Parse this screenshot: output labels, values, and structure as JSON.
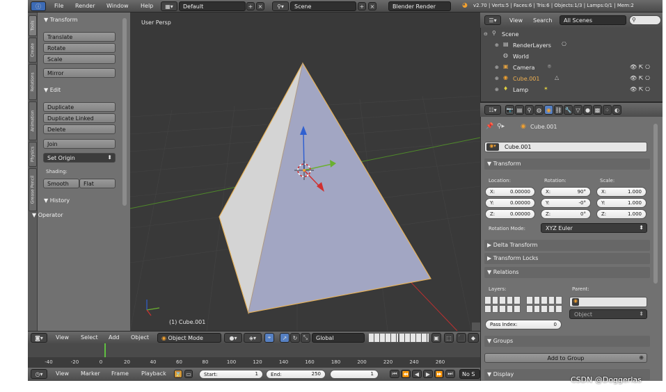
{
  "menu": {
    "items": [
      "File",
      "Render",
      "Window",
      "Help"
    ],
    "screen_layout": "Default",
    "scene": "Scene",
    "engine": "Blender Render",
    "stats": "v2.70 | Verts:5 | Faces:6 | Tris:6 | Objects:1/3 | Lamps:0/1 | Mem:2"
  },
  "toolshelf": {
    "tabs": [
      "Tools",
      "Create",
      "Relations",
      "Animation",
      "Physics",
      "Grease Pencil"
    ],
    "transform_header": "▼ Transform",
    "translate": "Translate",
    "rotate": "Rotate",
    "scale": "Scale",
    "mirror": "Mirror",
    "edit_header": "▼ Edit",
    "duplicate": "Duplicate",
    "duplicate_linked": "Duplicate Linked",
    "delete": "Delete",
    "join": "Join",
    "set_origin": "Set Origin",
    "shading_label": "Shading:",
    "smooth": "Smooth",
    "flat": "Flat",
    "history_header": "▼ History",
    "operator_header": "▼ Operator"
  },
  "viewport": {
    "view_label": "User Persp",
    "object_label": "(1) Cube.001"
  },
  "view3d_header": {
    "view": "View",
    "select": "Select",
    "add": "Add",
    "object": "Object",
    "mode": "Object Mode",
    "orientation": "Global"
  },
  "timeline": {
    "ticks": [
      "-40",
      "-20",
      "0",
      "20",
      "40",
      "60",
      "80",
      "100",
      "120",
      "140",
      "160",
      "180",
      "200",
      "220",
      "240",
      "260"
    ],
    "view": "View",
    "marker": "Marker",
    "frame": "Frame",
    "playback": "Playback",
    "start_label": "Start:",
    "start_value": "1",
    "end_label": "End:",
    "end_value": "250",
    "current_frame": "1",
    "no_sync": "No S"
  },
  "outliner": {
    "view": "View",
    "search": "Search",
    "filter": "All Scenes",
    "rows": [
      "Scene",
      "RenderLayers",
      "World",
      "Camera",
      "Cube.001",
      "Lamp"
    ]
  },
  "properties": {
    "breadcrumb_object": "Cube.001",
    "object_name": "Cube.001",
    "transform_header": "▼ Transform",
    "location_label": "Location:",
    "rotation_label": "Rotation:",
    "scale_label": "Scale:",
    "loc": [
      {
        "axis": "X:",
        "value": "0.00000"
      },
      {
        "axis": "Y:",
        "value": "0.00000"
      },
      {
        "axis": "Z:",
        "value": "0.00000"
      }
    ],
    "rot": [
      {
        "axis": "X:",
        "value": "90°"
      },
      {
        "axis": "Y:",
        "value": "-0°"
      },
      {
        "axis": "Z:",
        "value": "0°"
      }
    ],
    "scl": [
      {
        "axis": "X:",
        "value": "1.000"
      },
      {
        "axis": "Y:",
        "value": "1.000"
      },
      {
        "axis": "Z:",
        "value": "1.000"
      }
    ],
    "rotation_mode_label": "Rotation Mode:",
    "rotation_mode": "XYZ Euler",
    "delta_transform": "▶ Delta Transform",
    "transform_locks": "▶ Transform Locks",
    "relations_header": "▼ Relations",
    "layers_label": "Layers:",
    "parent_label": "Parent:",
    "parent_type": "Object",
    "pass_index_label": "Pass Index:",
    "pass_index_value": "0",
    "groups_header": "▼ Groups",
    "add_to_group": "Add to Group",
    "display_header": "▼ Display"
  },
  "watermark": "CSDN @Doggerlas",
  "colors": {
    "ui_gray": "#717171",
    "viewport_bg": "#393939",
    "x_axis": "#d03030",
    "y_axis": "#6ab030",
    "z_axis": "#3060d0",
    "selected_outline": "#e6b25a"
  }
}
